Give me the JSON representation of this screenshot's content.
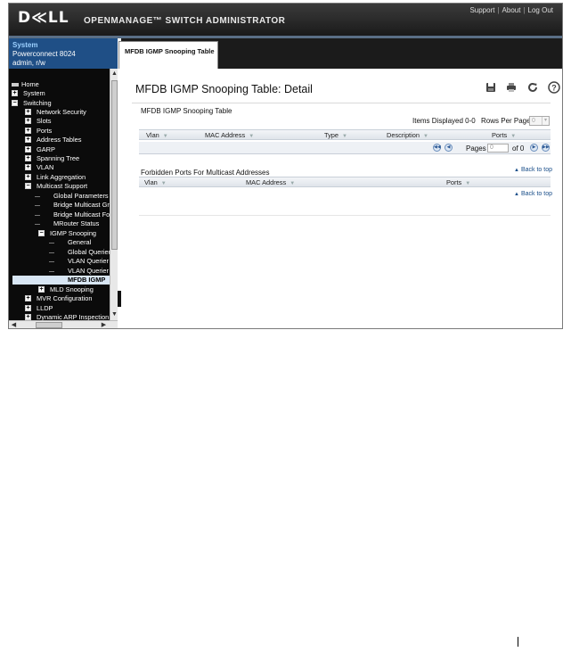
{
  "header": {
    "logo": "D≪LL",
    "product": "OPENMANAGE™ SWITCH ADMINISTRATOR",
    "links": [
      "Support",
      "About",
      "Log Out"
    ],
    "link_separator": "|"
  },
  "system_panel": {
    "title": "System",
    "model": "Powerconnect 8024",
    "user": "admin, r/w"
  },
  "nav": {
    "items": [
      {
        "label": "Home",
        "icon": "home-icon"
      },
      {
        "label": "System",
        "toggle": "+"
      },
      {
        "label": "Switching",
        "toggle": "−"
      },
      {
        "label": "Network Security",
        "toggle": "+"
      },
      {
        "label": "Slots",
        "toggle": "+"
      },
      {
        "label": "Ports",
        "toggle": "+"
      },
      {
        "label": "Address Tables",
        "toggle": "+"
      },
      {
        "label": "GARP",
        "toggle": "+"
      },
      {
        "label": "Spanning Tree",
        "toggle": "+"
      },
      {
        "label": "VLAN",
        "toggle": "+"
      },
      {
        "label": "Link Aggregation",
        "toggle": "+"
      },
      {
        "label": "Multicast Support",
        "toggle": "−"
      },
      {
        "label": "Global Parameters"
      },
      {
        "label": "Bridge Multicast Gr"
      },
      {
        "label": "Bridge Multicast Fo"
      },
      {
        "label": "MRouter Status"
      },
      {
        "label": "IGMP Snooping",
        "toggle": "−"
      },
      {
        "label": "General"
      },
      {
        "label": "Global Querier"
      },
      {
        "label": "VLAN Querier"
      },
      {
        "label": "VLAN Querier S"
      },
      {
        "label": "MFDB IGMP"
      },
      {
        "label": "MLD Snooping",
        "toggle": "+"
      },
      {
        "label": "MVR Configuration",
        "toggle": "+"
      },
      {
        "label": "LLDP",
        "toggle": "+"
      },
      {
        "label": "Dynamic ARP Inspection",
        "toggle": "+"
      }
    ]
  },
  "tab": {
    "label": "MFDB IGMP Snooping Table"
  },
  "page": {
    "title": "MFDB IGMP Snooping Table: Detail",
    "tools": {
      "save": "H",
      "print": "⎙",
      "refresh": "↻",
      "help": "?"
    }
  },
  "table1": {
    "title": "MFDB IGMP Snooping Table",
    "items_displayed": "Items Displayed 0-0",
    "rows_per_page_label": "Rows Per Page",
    "rows_per_page_value": "0",
    "columns": [
      "Vlan",
      "MAC Address",
      "Type",
      "Description",
      "Ports"
    ],
    "pages_label": "Pages",
    "page_value": "0",
    "of_label": "of 0"
  },
  "table2": {
    "title": "Forbidden Ports For Multicast Addresses",
    "columns": [
      "Vlan",
      "MAC Address",
      "Ports"
    ]
  },
  "back_to_top": "Back to top"
}
